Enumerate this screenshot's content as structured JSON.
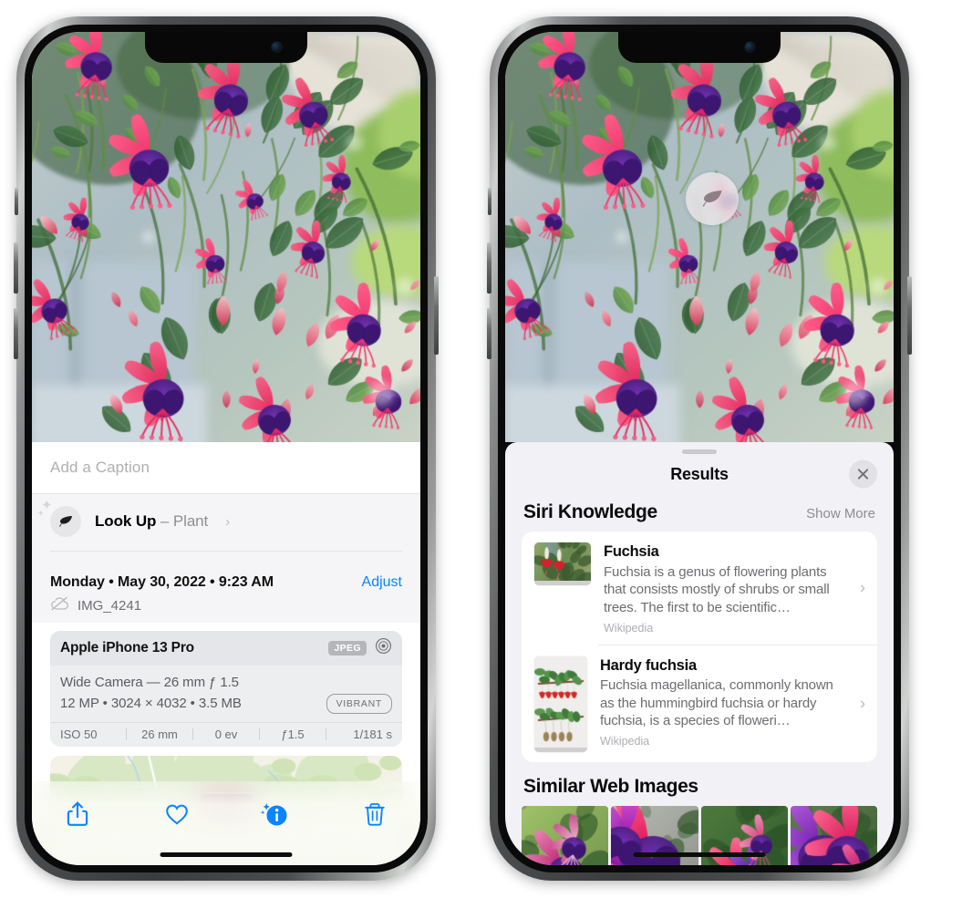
{
  "left_phone": {
    "photo_alt": "Fuchsia flowers hanging basket",
    "caption_placeholder": "Add a Caption",
    "caption_value": "",
    "lookup": {
      "label": "Look Up",
      "dash": " – ",
      "subject": "Plant",
      "chevron": "›",
      "icon": "leaf-icon",
      "sparkle": "✦"
    },
    "metadata": {
      "date_line": "Monday • May 30, 2022 • 9:23 AM",
      "adjust_label": "Adjust",
      "filename": "IMG_4241",
      "cloud_icon": "icloud-slash-icon"
    },
    "exif": {
      "model": "Apple iPhone 13 Pro",
      "format_badge": "JPEG",
      "lens_icon": "aperture-icon",
      "lens_line": "Wide Camera — 26 mm ƒ 1.5",
      "size_line": "12 MP • 3024 × 4032 • 3.5 MB",
      "style_badge": "VIBRANT",
      "stats": [
        "ISO 50",
        "26 mm",
        "0 ev",
        "ƒ1.5",
        "1/181 s"
      ]
    },
    "map": {
      "pin_alt": "photo location thumbnail"
    },
    "toolbar": {
      "share_label": "share-button",
      "favorite_label": "favorite-button",
      "info_label": "info-button",
      "delete_label": "delete-button"
    }
  },
  "right_phone": {
    "marker": {
      "icon": "leaf-icon"
    },
    "sheet": {
      "title": "Results",
      "close_label": "✕"
    },
    "siri_knowledge": {
      "heading": "Siri Knowledge",
      "show_more": "Show More",
      "items": [
        {
          "title": "Fuchsia",
          "description": "Fuchsia is a genus of flowering plants that consists mostly of shrubs or small trees. The first to be scientific…",
          "source": "Wikipedia",
          "chevron": "›"
        },
        {
          "title": "Hardy fuchsia",
          "description": "Fuchsia magellanica, commonly known as the hummingbird fuchsia or hardy fuchsia, is a species of floweri…",
          "source": "Wikipedia",
          "chevron": "›"
        }
      ]
    },
    "similar_web_images": {
      "heading": "Similar Web Images",
      "count": 4
    }
  },
  "colors": {
    "accent_blue": "#0a84ff",
    "sheet_bg": "#f2f1f6",
    "card_bg": "#ffffff",
    "secondary_text": "#6d6d72",
    "tertiary_text": "#aeaeb3"
  }
}
